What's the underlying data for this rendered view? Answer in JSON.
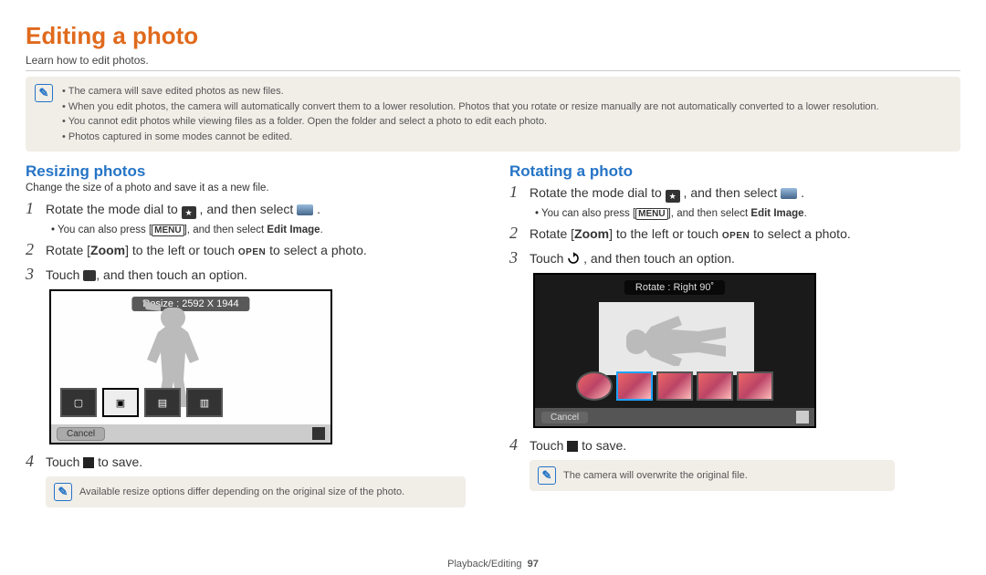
{
  "title": "Editing a photo",
  "subtitle": "Learn how to edit photos.",
  "info": {
    "items": [
      "The camera will save edited photos as new files.",
      "When you edit photos, the camera will automatically convert them to a lower resolution. Photos that you rotate or resize manually are not automatically converted to a lower resolution.",
      "You cannot edit photos while viewing files as a folder. Open the folder and select a photo to edit each photo.",
      "Photos captured in some modes cannot be edited."
    ]
  },
  "left": {
    "heading": "Resizing photos",
    "desc": "Change the size of a photo and save it as a new file.",
    "step1a": "Rotate the mode dial to ",
    "step1b": ", and then select ",
    "step1_end": ".",
    "menu_note_a": "You can also press [",
    "menu_label": "MENU",
    "menu_note_b": "], and then select ",
    "menu_bold": "Edit Image",
    "menu_note_end": ".",
    "step2a": "Rotate [",
    "step2_zoom": "Zoom",
    "step2b": "] to the left or touch ",
    "step2_open": "OPEN",
    "step2c": " to select a photo.",
    "step3a": "Touch ",
    "step3b": ", and then touch an option.",
    "preview_tag": "Resize : 2592 X 1944",
    "cancel": "Cancel",
    "step4a": "Touch ",
    "step4b": " to save.",
    "bottom_note": "Available resize options differ depending on the original size of the photo."
  },
  "right": {
    "heading": "Rotating a photo",
    "step1a": "Rotate the mode dial to ",
    "step1b": ", and then select ",
    "step1_end": ".",
    "menu_note_a": "You can also press [",
    "menu_label": "MENU",
    "menu_note_b": "], and then select ",
    "menu_bold": "Edit Image",
    "menu_note_end": ".",
    "step2a": "Rotate [",
    "step2_zoom": "Zoom",
    "step2b": "] to the left or touch ",
    "step2_open": "OPEN",
    "step2c": " to select a photo.",
    "step3a": "Touch ",
    "step3b": ", and then touch an option.",
    "preview_tag": "Rotate : Right 90˚",
    "cancel": "Cancel",
    "step4a": "Touch ",
    "step4b": " to save.",
    "bottom_note": "The camera will overwrite the original file."
  },
  "footer": {
    "section": "Playback/Editing",
    "page": "97"
  }
}
